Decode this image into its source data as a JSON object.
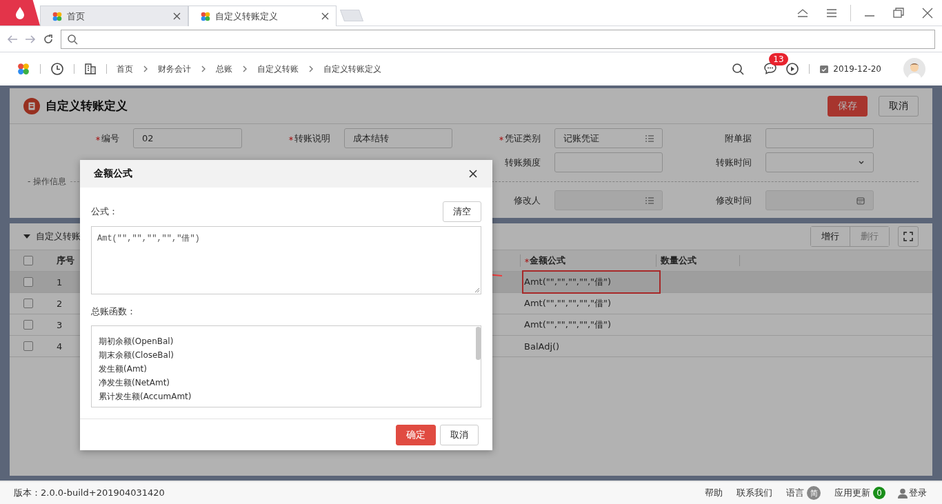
{
  "browser": {
    "tabs": [
      {
        "label": "首页",
        "selected": false
      },
      {
        "label": "自定义转账定义",
        "selected": true
      }
    ]
  },
  "app_header": {
    "breadcrumb": [
      "首页",
      "财务会计",
      "总账",
      "自定义转账",
      "自定义转账定义"
    ],
    "message_count": "13",
    "date": "2019-12-20"
  },
  "page": {
    "title": "自定义转账定义",
    "buttons": [
      {
        "label": "保存",
        "kind": "primary"
      },
      {
        "label": "取消",
        "kind": "default"
      }
    ]
  },
  "form": {
    "rows": [
      [
        {
          "label": "编号",
          "required": true,
          "value": "02",
          "kind": "text",
          "disabled": false
        },
        {
          "label": "转账说明",
          "required": true,
          "value": "成本结转",
          "kind": "text",
          "disabled": false
        },
        {
          "label": "凭证类别",
          "required": true,
          "value": "记账凭证",
          "kind": "list",
          "disabled": false
        },
        {
          "label": "附单据",
          "required": false,
          "kind": "text",
          "disabled": false
        }
      ],
      [
        {
          "label": "转账频度",
          "required": false,
          "kind": "text",
          "disabled": false
        },
        {
          "label": "转账时间",
          "required": false,
          "kind": "select",
          "disabled": false
        }
      ],
      [
        {
          "label": "修改人",
          "required": false,
          "kind": "list",
          "disabled": true
        },
        {
          "label": "修改时间",
          "required": false,
          "kind": "date",
          "disabled": true
        }
      ]
    ],
    "section_label": "- 操作信息"
  },
  "table": {
    "title": "自定义转账",
    "expanded": true,
    "all_checked": false,
    "toolbar": [
      {
        "label": "增行",
        "disabled": false
      },
      {
        "label": "删行",
        "disabled": true
      }
    ],
    "columns": [
      {
        "label": "序号",
        "required": false
      },
      {
        "label": "金额公式",
        "required": true
      },
      {
        "label": "数量公式",
        "required": false
      }
    ],
    "rows": [
      {
        "checked": false,
        "selected": true,
        "highlighted": true,
        "index": "1",
        "amount_formula": "Amt(\"\",\"\",\"\",\"\",\"借\")"
      },
      {
        "checked": false,
        "selected": false,
        "highlighted": false,
        "index": "2",
        "amount_formula": "Amt(\"\",\"\",\"\",\"\",\"借\")"
      },
      {
        "checked": false,
        "selected": false,
        "highlighted": false,
        "index": "3",
        "amount_formula": "Amt(\"\",\"\",\"\",\"\",\"借\")"
      },
      {
        "checked": false,
        "selected": false,
        "highlighted": false,
        "index": "4",
        "amount_formula": "BalAdj()"
      }
    ]
  },
  "dialog": {
    "title": "金额公式",
    "formula_label": "公式：",
    "clear_button": "清空",
    "formula": "Amt(\"\",\"\",\"\",\"\",\"借\")",
    "functions_label": "总账函数：",
    "functions": [
      "期初余额(OpenBal)",
      "期末余额(CloseBal)",
      "发生额(Amt)",
      "净发生额(NetAmt)",
      "累计发生额(AccumAmt)"
    ],
    "buttons": [
      {
        "label": "确定",
        "kind": "primary"
      },
      {
        "label": "取消",
        "kind": "default"
      }
    ]
  },
  "footer": {
    "version": "版本：2.0.0-build+201904031420",
    "links": [
      "帮助",
      "联系我们"
    ],
    "language_label": "语言",
    "language": "简",
    "updates_label": "应用更新",
    "updates": "0",
    "login": "登录"
  }
}
